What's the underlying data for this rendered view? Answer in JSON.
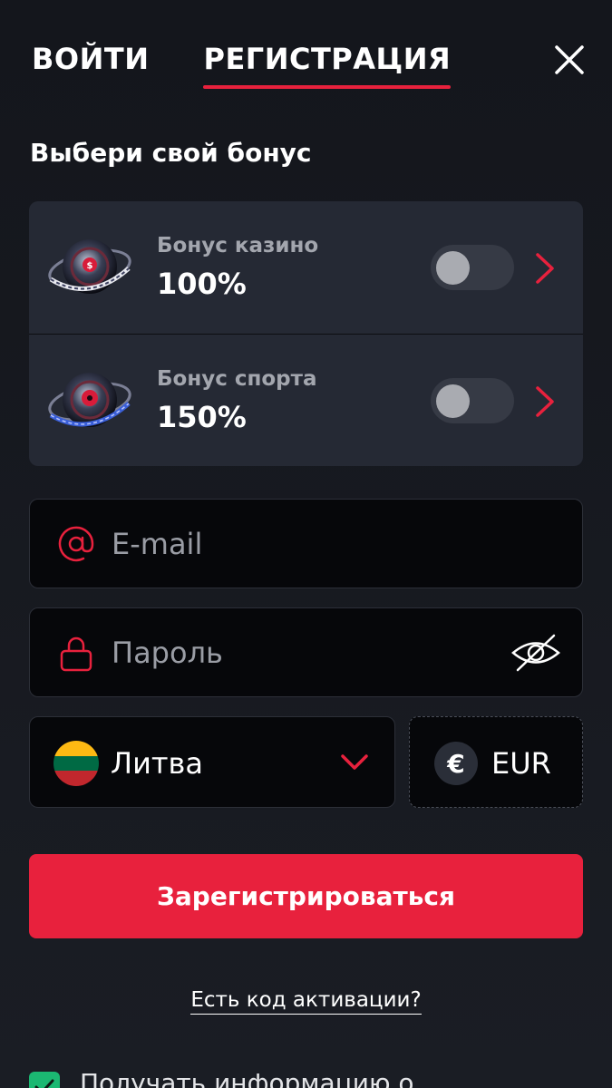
{
  "tabs": {
    "login": "ВОЙТИ",
    "register": "РЕГИСТРАЦИЯ"
  },
  "bonus_section": {
    "title": "Выбери свой бонус",
    "items": [
      {
        "name": "Бонус казино",
        "value": "100%",
        "enabled": false
      },
      {
        "name": "Бонус спорта",
        "value": "150%",
        "enabled": false
      }
    ]
  },
  "form": {
    "email_placeholder": "E-mail",
    "password_placeholder": "Пароль",
    "country": "Литва",
    "currency_symbol": "€",
    "currency": "EUR",
    "submit_label": "Зарегистрироваться",
    "activation_link": "Есть код активации?",
    "newsletter_label": "Получать информацию о",
    "newsletter_checked": true
  },
  "colors": {
    "accent": "#e8213d",
    "background": "#14161c",
    "card": "#252934",
    "input_bg": "#06070a",
    "check": "#1bb872",
    "flag_lithuania": [
      "#fdb913",
      "#006a44",
      "#c1272d"
    ]
  },
  "icons": {
    "close": "close-icon",
    "email": "at-icon",
    "password": "lock-icon",
    "toggle_visibility": "eye-off-icon",
    "dropdown": "chevron-down-icon",
    "bonus_arrow": "chevron-right-icon"
  }
}
